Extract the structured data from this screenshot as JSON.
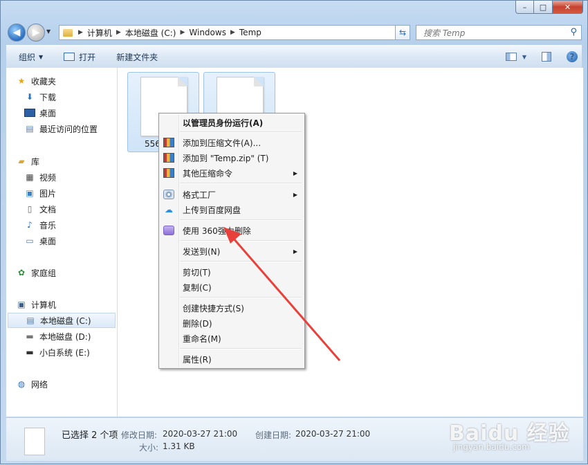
{
  "window": {
    "caption_buttons": {
      "min_glyph": "–",
      "max_glyph": "□",
      "close_glyph": "✕"
    }
  },
  "address_bar": {
    "crumbs": [
      "计算机",
      "本地磁盘 (C:)",
      "Windows",
      "Temp"
    ],
    "search_placeholder": "搜索 Temp"
  },
  "toolbar": {
    "organize": "组织",
    "open": "打开",
    "new_folder": "新建文件夹"
  },
  "nav_pane": {
    "favorites": "收藏夹",
    "downloads": "下载",
    "desktop": "桌面",
    "recent": "最近访问的位置",
    "libraries": "库",
    "videos": "视频",
    "pictures": "图片",
    "documents": "文档",
    "music": "音乐",
    "lib_desktop": "桌面",
    "homegroup": "家庭组",
    "computer": "计算机",
    "drive_c": "本地磁盘 (C:)",
    "drive_d": "本地磁盘 (D:)",
    "drive_e": "小白系统 (E:)",
    "network": "网络"
  },
  "files": [
    {
      "name": "556"
    },
    {
      "name": ""
    }
  ],
  "context_menu": {
    "run_as_admin": "以管理员身份运行(A)",
    "add_archive": "添加到压缩文件(A)...",
    "add_zip": "添加到 \"Temp.zip\" (T)",
    "other_compress": "其他压缩命令",
    "format_factory": "格式工厂",
    "baidu_upload": "上传到百度网盘",
    "shred_360": "使用 360强力删除",
    "send_to": "发送到(N)",
    "cut": "剪切(T)",
    "copy": "复制(C)",
    "create_shortcut": "创建快捷方式(S)",
    "delete": "删除(D)",
    "rename": "重命名(M)",
    "properties": "属性(R)"
  },
  "details": {
    "selected": "已选择 2 个项",
    "modified_label": "修改日期:",
    "modified_value": "2020-03-27 21:00",
    "created_label": "创建日期:",
    "created_value": "2020-03-27 21:00",
    "size_label": "大小:",
    "size_value": "1.31 KB"
  },
  "watermark": {
    "main": "Baidu 经验",
    "sub": "jingyan.baidu.com"
  },
  "annotation": {
    "arrow_color": "#e8403a"
  }
}
